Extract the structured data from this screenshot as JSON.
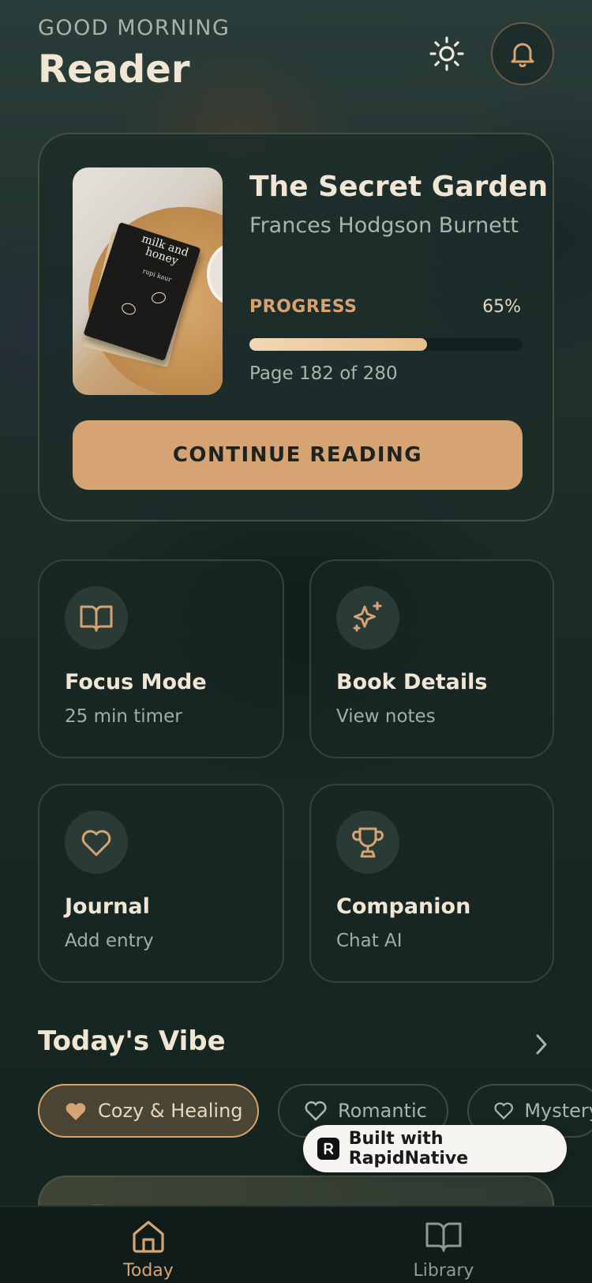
{
  "header": {
    "greeting": "GOOD MORNING",
    "title": "Reader",
    "theme_icon": "sun-icon",
    "notification_icon": "bell-icon"
  },
  "current_book": {
    "title": "The Secret Garden",
    "author": "Frances Hodgson Burnett",
    "cover_image": {
      "book_title": "milk and honey",
      "book_author": "rupi kaur"
    },
    "progress_label": "PROGRESS",
    "progress_percent": 65,
    "progress_text": "65%",
    "page_info": "Page 182 of 280",
    "continue_label": "CONTINUE READING"
  },
  "actions": [
    {
      "icon": "book-open-icon",
      "title": "Focus Mode",
      "subtitle": "25 min timer"
    },
    {
      "icon": "sparkles-icon",
      "title": "Book Details",
      "subtitle": "View notes"
    },
    {
      "icon": "heart-icon",
      "title": "Journal",
      "subtitle": "Add entry"
    },
    {
      "icon": "trophy-icon",
      "title": "Companion",
      "subtitle": "Chat AI"
    }
  ],
  "vibe": {
    "title": "Today's Vibe",
    "chips": [
      {
        "label": "Cozy & Healing",
        "active": true
      },
      {
        "label": "Romantic",
        "active": false
      },
      {
        "label": "Mystery",
        "active": false
      }
    ]
  },
  "badge": {
    "label": "Built with RapidNative"
  },
  "bottom_nav": [
    {
      "label": "Today",
      "icon": "home-icon",
      "active": true
    },
    {
      "label": "Library",
      "icon": "book-open-icon",
      "active": false
    }
  ],
  "colors": {
    "accent": "#d6a472",
    "accent_text": "#d7a270",
    "background": "#142522",
    "text_primary": "#f1e5d3",
    "text_muted": "#a9b4ad"
  }
}
